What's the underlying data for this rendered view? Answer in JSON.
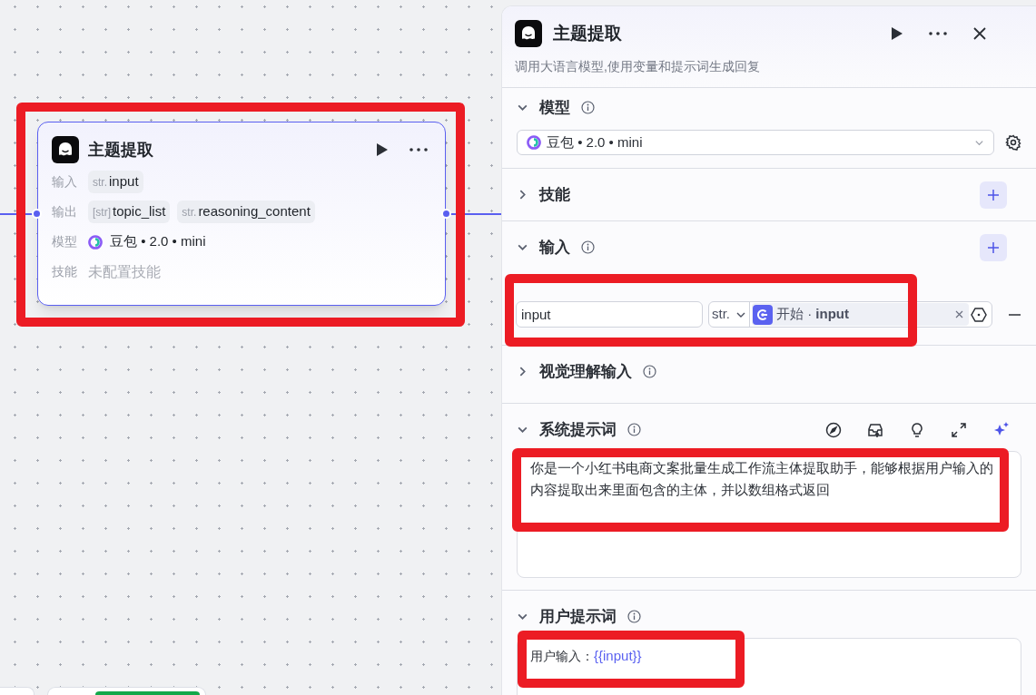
{
  "canvas": {
    "node": {
      "title": "主题提取",
      "selected": true,
      "rows": [
        {
          "label": "输入",
          "kind": "tags",
          "tags": [
            {
              "type": "str.",
              "name": "input"
            }
          ]
        },
        {
          "label": "输出",
          "kind": "tags",
          "tags": [
            {
              "type": "[str]",
              "name": "topic_list"
            },
            {
              "type": "str.",
              "name": "reasoning_content"
            }
          ]
        },
        {
          "label": "模型",
          "kind": "model",
          "value": "豆包 • 2.0 • mini"
        },
        {
          "label": "技能",
          "kind": "empty",
          "value": "未配置技能"
        }
      ]
    }
  },
  "panel": {
    "title": "主题提取",
    "description": "调用大语言模型,使用变量和提示词生成回复",
    "sections": [
      {
        "kind": "model",
        "title": "模型",
        "expanded": true,
        "info": true,
        "model": "豆包 • 2.0 • mini"
      },
      {
        "kind": "skills",
        "title": "技能",
        "expanded": false,
        "info": false,
        "add": true
      },
      {
        "kind": "inputs",
        "title": "输入",
        "expanded": true,
        "info": true,
        "add": true,
        "rows": [
          {
            "name": "input",
            "type": "str.",
            "reference": "开始 · **input**"
          }
        ]
      },
      {
        "kind": "vision",
        "title": "视觉理解输入",
        "expanded": false,
        "info": true
      },
      {
        "kind": "system_prompt",
        "title": "系统提示词",
        "expanded": true,
        "info": true,
        "text": "你是一个小红书电商文案批量生成工作流主体提取助手，能够根据用户输入的内容提取出来里面包含的主体，并以数组格式返回"
      },
      {
        "kind": "user_prompt",
        "title": "用户提示词",
        "expanded": true,
        "info": true,
        "label": "用户输入：",
        "variable": "{{input}}"
      }
    ]
  }
}
